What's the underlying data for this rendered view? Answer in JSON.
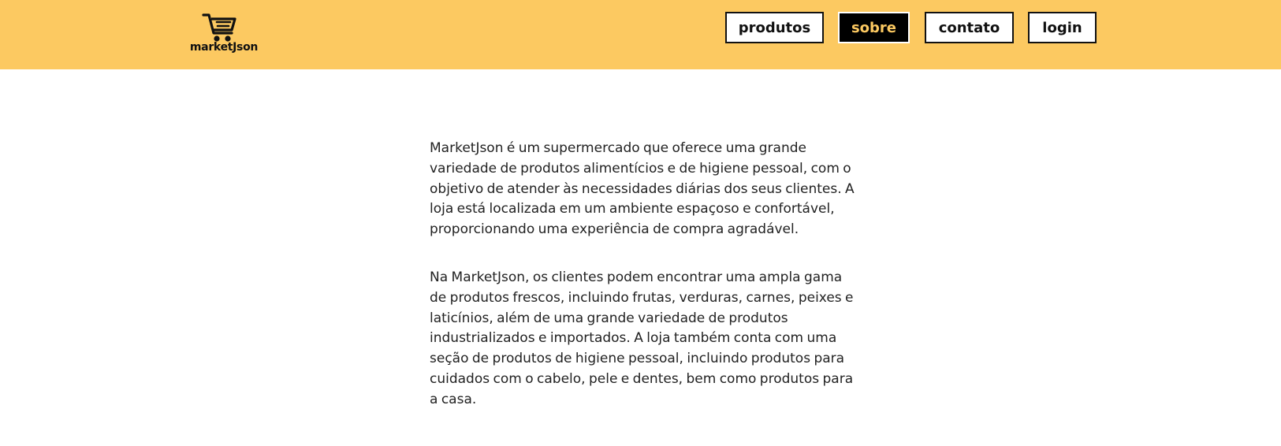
{
  "brand": {
    "name": "marketJson",
    "logo_icon": "shopping-cart-icon"
  },
  "nav": {
    "items": [
      {
        "label": "produtos",
        "active": false
      },
      {
        "label": "sobre",
        "active": true
      },
      {
        "label": "contato",
        "active": false
      },
      {
        "label": "login",
        "active": false
      }
    ]
  },
  "colors": {
    "header_bg": "#fcc961",
    "active_bg": "#000000",
    "active_text": "#fcc961"
  },
  "about": {
    "paragraphs": [
      "MarketJson é um supermercado que oferece uma grande variedade de produtos alimentícios e de higiene pessoal, com o objetivo de atender às necessidades diárias dos seus clientes. A loja está localizada em um ambiente espaçoso e confortável, proporcionando uma experiência de compra agradável.",
      "Na MarketJson, os clientes podem encontrar uma ampla gama de produtos frescos, incluindo frutas, verduras, carnes, peixes e laticínios, além de uma grande variedade de produtos industrializados e importados. A loja também conta com uma seção de produtos de higiene pessoal, incluindo produtos para cuidados com o cabelo, pele e dentes, bem como produtos para a casa."
    ]
  }
}
